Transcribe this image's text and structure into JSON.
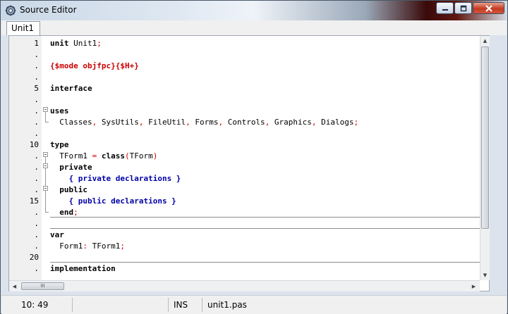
{
  "window": {
    "title": "Source Editor",
    "icon": "lazarus-gear-icon"
  },
  "controls": {
    "minimize_icon": "minimize-icon",
    "maximize_icon": "maximize-icon",
    "close_icon": "close-icon"
  },
  "tabs": [
    {
      "label": "Unit1"
    }
  ],
  "gutter": [
    "1",
    ".",
    ".",
    ".",
    "5",
    ".",
    ".",
    ".",
    ".",
    "10",
    ".",
    ".",
    ".",
    ".",
    "15",
    ".",
    ".",
    ".",
    ".",
    "20",
    "."
  ],
  "code_lines": [
    [
      {
        "t": "unit",
        "c": "kw"
      },
      {
        "t": " Unit1"
      },
      {
        "t": ";",
        "c": "sym"
      }
    ],
    [],
    [
      {
        "t": "{$mode objfpc}{$H+}",
        "c": "dir"
      }
    ],
    [],
    [
      {
        "t": "interface",
        "c": "kw"
      }
    ],
    [],
    [
      {
        "t": "uses",
        "c": "kw"
      }
    ],
    [
      {
        "t": "  Classes"
      },
      {
        "t": ",",
        "c": "sym"
      },
      {
        "t": " SysUtils"
      },
      {
        "t": ",",
        "c": "sym"
      },
      {
        "t": " FileUtil"
      },
      {
        "t": ",",
        "c": "sym"
      },
      {
        "t": " Forms"
      },
      {
        "t": ",",
        "c": "sym"
      },
      {
        "t": " Controls"
      },
      {
        "t": ",",
        "c": "sym"
      },
      {
        "t": " Graphics"
      },
      {
        "t": ",",
        "c": "sym"
      },
      {
        "t": " Dialogs"
      },
      {
        "t": ";",
        "c": "sym"
      }
    ],
    [],
    [
      {
        "t": "type",
        "c": "kw"
      }
    ],
    [
      {
        "t": "  TForm1 "
      },
      {
        "t": "=",
        "c": "sym"
      },
      {
        "t": " "
      },
      {
        "t": "class",
        "c": "kw"
      },
      {
        "t": "(",
        "c": "sym"
      },
      {
        "t": "TForm"
      },
      {
        "t": ")",
        "c": "sym"
      }
    ],
    [
      {
        "t": "  "
      },
      {
        "t": "private",
        "c": "kw"
      }
    ],
    [
      {
        "t": "    { private declarations }",
        "c": "cmt"
      }
    ],
    [
      {
        "t": "  "
      },
      {
        "t": "public",
        "c": "kw"
      }
    ],
    [
      {
        "t": "    { public declarations }",
        "c": "cmt"
      }
    ],
    [
      {
        "t": "  "
      },
      {
        "t": "end",
        "c": "kw"
      },
      {
        "t": ";",
        "c": "sym"
      }
    ],
    [],
    [
      {
        "t": "var",
        "c": "kw"
      }
    ],
    [
      {
        "t": "  Form1"
      },
      {
        "t": ":",
        "c": "sym"
      },
      {
        "t": " TForm1"
      },
      {
        "t": ";",
        "c": "sym"
      }
    ],
    [],
    [
      {
        "t": "implementation",
        "c": "kw"
      }
    ]
  ],
  "colors": {
    "kw": "#000000",
    "sym": "#cc0000",
    "dir": "#cc0000",
    "cmt": "#0000a8",
    "text": "#000000"
  },
  "scrollbar": {
    "hthumb_label": "III"
  },
  "status": {
    "position": "10: 49",
    "mode": "INS",
    "filename": "unit1.pas"
  }
}
